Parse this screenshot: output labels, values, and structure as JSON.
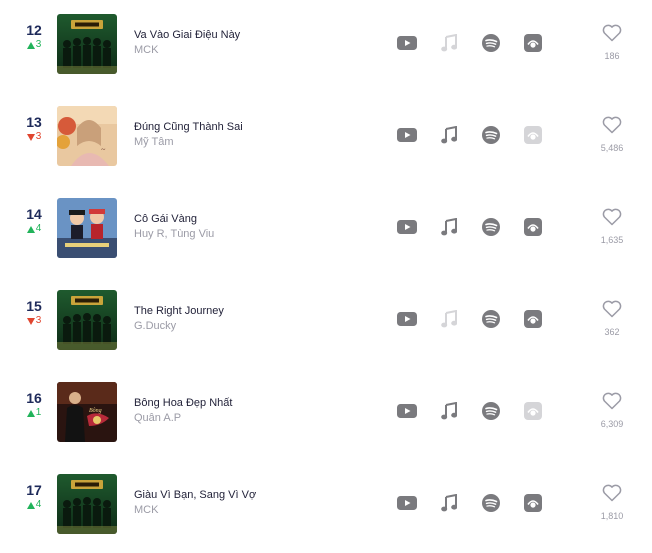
{
  "rows": [
    {
      "rank": "12",
      "trend": "up",
      "change": "3",
      "title": "Va Vào Giai Điệu Này",
      "artist": "MCK",
      "likes": "186",
      "cover": "rapviet",
      "available": {
        "youtube": true,
        "apple": false,
        "spotify": true,
        "nct": true
      }
    },
    {
      "rank": "13",
      "trend": "down",
      "change": "3",
      "title": "Đúng Cũng Thành Sai",
      "artist": "Mỹ Tâm",
      "likes": "5,486",
      "cover": "mytam",
      "available": {
        "youtube": true,
        "apple": true,
        "spotify": true,
        "nct": false
      }
    },
    {
      "rank": "14",
      "trend": "up",
      "change": "4",
      "title": "Cô Gái Vàng",
      "artist": "Huy R, Tùng Viu",
      "likes": "1,635",
      "cover": "cogaivang",
      "available": {
        "youtube": true,
        "apple": true,
        "spotify": true,
        "nct": true
      }
    },
    {
      "rank": "15",
      "trend": "down",
      "change": "3",
      "title": "The Right Journey",
      "artist": "G.Ducky",
      "likes": "362",
      "cover": "rapviet",
      "available": {
        "youtube": true,
        "apple": false,
        "spotify": true,
        "nct": true
      }
    },
    {
      "rank": "16",
      "trend": "up",
      "change": "1",
      "title": "Bông Hoa Đẹp Nhất",
      "artist": "Quân A.P",
      "likes": "6,309",
      "cover": "bonghoa",
      "available": {
        "youtube": true,
        "apple": true,
        "spotify": true,
        "nct": false
      }
    },
    {
      "rank": "17",
      "trend": "up",
      "change": "4",
      "title": "Giàu Vì Bạn, Sang Vì Vợ",
      "artist": "MCK",
      "likes": "1,810",
      "cover": "rapviet",
      "available": {
        "youtube": true,
        "apple": true,
        "spotify": true,
        "nct": true
      }
    }
  ],
  "icons": {
    "youtube": "youtube-icon",
    "apple": "apple-music-icon",
    "spotify": "spotify-icon",
    "nct": "nhaccuatui-icon",
    "like": "heart-icon"
  },
  "colors": {
    "up": "#21b35a",
    "down": "#e0452f",
    "rank": "#1e2a5a",
    "icon_on": "#7a7a7e",
    "icon_off": "#d5d5d8"
  }
}
